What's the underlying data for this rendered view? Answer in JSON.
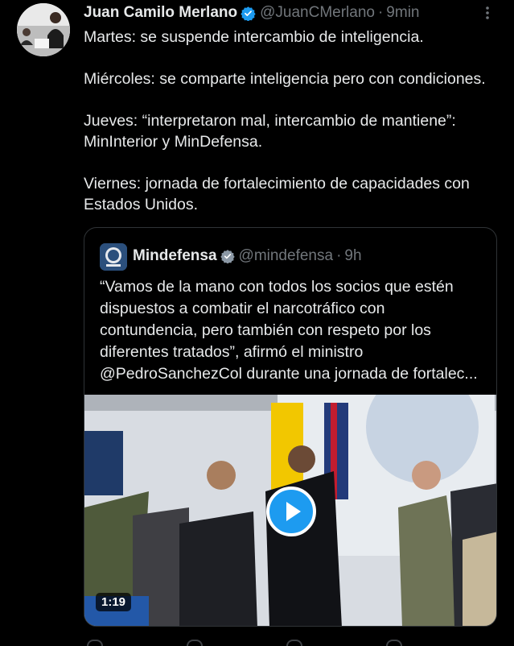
{
  "tweet": {
    "author_name": "Juan Camilo Merlano",
    "handle": "@JuanCMerlano",
    "separator": "·",
    "time": "9min",
    "text": "Martes: se suspende intercambio de inteligencia.\n\nMiércoles: se comparte inteligencia pero con condiciones.\n\nJueves: “interpretaron mal, intercambio de mantiene”: MinInterior y MinDefensa.\n\nViernes: jornada de fortalecimiento de capacidades con Estados Unidos."
  },
  "quoted": {
    "author_name": "Mindefensa",
    "handle": "@mindefensa",
    "separator": "·",
    "time": "9h",
    "avatar_text": "Defensa",
    "text": "“Vamos de la mano con todos los socios que estén dispuestos a combatir el narcotráfico con contundencia, pero también con respeto por los diferentes tratados”, afirmó el ministro @PedroSanchezCol durante una jornada de fortalec...",
    "video_duration": "1:19"
  },
  "colors": {
    "background": "#000000",
    "text": "#e7e9ea",
    "secondary": "#71767b",
    "verified": "#1d9bf0",
    "play_button": "#1d9bf0"
  },
  "icons": [
    "verified-badge-icon",
    "more-options-icon",
    "play-icon"
  ]
}
